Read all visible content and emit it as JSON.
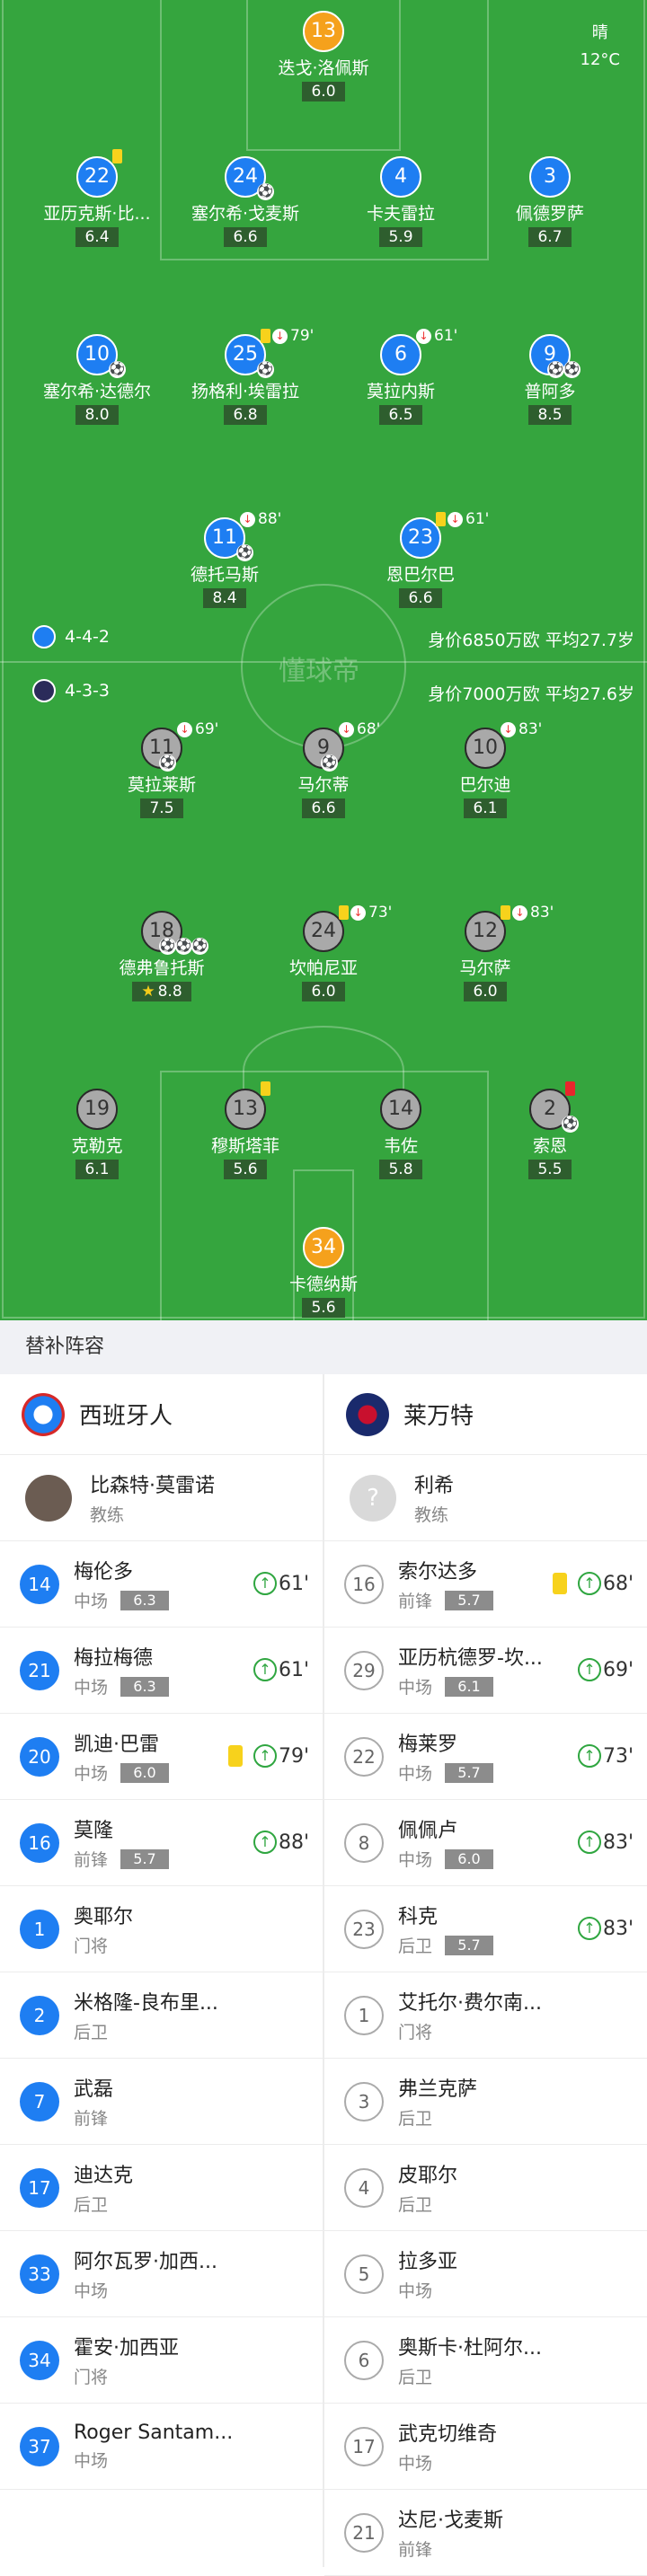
{
  "pitch": {
    "weather": "晴",
    "temperature": "12°C",
    "watermark": "懂球帝",
    "home": {
      "formation": "4-4-2",
      "value_line": "身价6850万欧 平均27.7岁",
      "color": "#1e7ef2"
    },
    "away": {
      "formation": "4-3-3",
      "value_line": "身价7000万欧 平均27.6岁",
      "color": "#a9a9a9"
    },
    "players": {
      "p1": {
        "num": "13",
        "name": "迭戈·洛佩斯",
        "rating": "6.0"
      },
      "p2": {
        "num": "22",
        "name": "亚历克斯·比...",
        "rating": "6.4"
      },
      "p3": {
        "num": "24",
        "name": "塞尔希·戈麦斯",
        "rating": "6.6"
      },
      "p4": {
        "num": "4",
        "name": "卡夫雷拉",
        "rating": "5.9"
      },
      "p5": {
        "num": "3",
        "name": "佩德罗萨",
        "rating": "6.7"
      },
      "p6": {
        "num": "10",
        "name": "塞尔希·达德尔",
        "rating": "8.0"
      },
      "p7": {
        "num": "25",
        "name": "扬格利·埃雷拉",
        "rating": "6.8",
        "sub": "79'"
      },
      "p8": {
        "num": "6",
        "name": "莫拉内斯",
        "rating": "6.5",
        "sub": "61'"
      },
      "p9": {
        "num": "9",
        "name": "普阿多",
        "rating": "8.5"
      },
      "p10": {
        "num": "11",
        "name": "德托马斯",
        "rating": "8.4",
        "sub": "88'"
      },
      "p11": {
        "num": "23",
        "name": "恩巴尔巴",
        "rating": "6.6",
        "sub": "61'"
      },
      "a1": {
        "num": "11",
        "name": "莫拉莱斯",
        "rating": "7.5",
        "sub": "69'"
      },
      "a2": {
        "num": "9",
        "name": "马尔蒂",
        "rating": "6.6",
        "sub": "68'"
      },
      "a3": {
        "num": "10",
        "name": "巴尔迪",
        "rating": "6.1",
        "sub": "83'"
      },
      "a4": {
        "num": "18",
        "name": "德弗鲁托斯",
        "rating": "8.8"
      },
      "a5": {
        "num": "24",
        "name": "坎帕尼亚",
        "rating": "6.0",
        "sub": "73'"
      },
      "a6": {
        "num": "12",
        "name": "马尔萨",
        "rating": "6.0",
        "sub": "83'"
      },
      "a7": {
        "num": "19",
        "name": "克勒克",
        "rating": "6.1"
      },
      "a8": {
        "num": "13",
        "name": "穆斯塔菲",
        "rating": "5.6"
      },
      "a9": {
        "num": "14",
        "name": "韦佐",
        "rating": "5.8"
      },
      "a10": {
        "num": "2",
        "name": "索恩",
        "rating": "5.5"
      },
      "a11": {
        "num": "34",
        "name": "卡德纳斯",
        "rating": "5.6"
      }
    }
  },
  "subs": {
    "title": "替补阵容",
    "home": {
      "team": "西班牙人",
      "coach_name": "比森特·莫雷诺",
      "coach_role": "教练",
      "players": [
        {
          "num": "14",
          "name": "梅伦多",
          "pos": "中场",
          "rating": "6.3",
          "in": "61'"
        },
        {
          "num": "21",
          "name": "梅拉梅德",
          "pos": "中场",
          "rating": "6.3",
          "in": "61'"
        },
        {
          "num": "20",
          "name": "凯迪·巴雷",
          "pos": "中场",
          "rating": "6.0",
          "in": "79'"
        },
        {
          "num": "16",
          "name": "莫隆",
          "pos": "前锋",
          "rating": "5.7",
          "in": "88'"
        },
        {
          "num": "1",
          "name": "奥耶尔",
          "pos": "门将"
        },
        {
          "num": "2",
          "name": "米格隆-良布里...",
          "pos": "后卫"
        },
        {
          "num": "7",
          "name": "武磊",
          "pos": "前锋"
        },
        {
          "num": "17",
          "name": "迪达克",
          "pos": "后卫"
        },
        {
          "num": "33",
          "name": "阿尔瓦罗·加西...",
          "pos": "中场"
        },
        {
          "num": "34",
          "name": "霍安·加西亚",
          "pos": "门将"
        },
        {
          "num": "37",
          "name": "Roger Santam...",
          "pos": "中场"
        }
      ]
    },
    "away": {
      "team": "莱万特",
      "coach_name": "利希",
      "coach_role": "教练",
      "players": [
        {
          "num": "16",
          "name": "索尔达多",
          "pos": "前锋",
          "rating": "5.7",
          "in": "68'"
        },
        {
          "num": "29",
          "name": "亚历杭德罗-坎...",
          "pos": "中场",
          "rating": "6.1",
          "in": "69'"
        },
        {
          "num": "22",
          "name": "梅莱罗",
          "pos": "中场",
          "rating": "5.7",
          "in": "73'"
        },
        {
          "num": "8",
          "name": "佩佩卢",
          "pos": "中场",
          "rating": "6.0",
          "in": "83'"
        },
        {
          "num": "23",
          "name": "科克",
          "pos": "后卫",
          "rating": "5.7",
          "in": "83'"
        },
        {
          "num": "1",
          "name": "艾托尔·费尔南...",
          "pos": "门将"
        },
        {
          "num": "3",
          "name": "弗兰克萨",
          "pos": "后卫"
        },
        {
          "num": "4",
          "name": "皮耶尔",
          "pos": "后卫"
        },
        {
          "num": "5",
          "name": "拉多亚",
          "pos": "中场"
        },
        {
          "num": "6",
          "name": "奥斯卡·杜阿尔...",
          "pos": "后卫"
        },
        {
          "num": "17",
          "name": "武克切维奇",
          "pos": "中场"
        },
        {
          "num": "21",
          "name": "达尼·戈麦斯",
          "pos": "前锋"
        }
      ]
    }
  }
}
